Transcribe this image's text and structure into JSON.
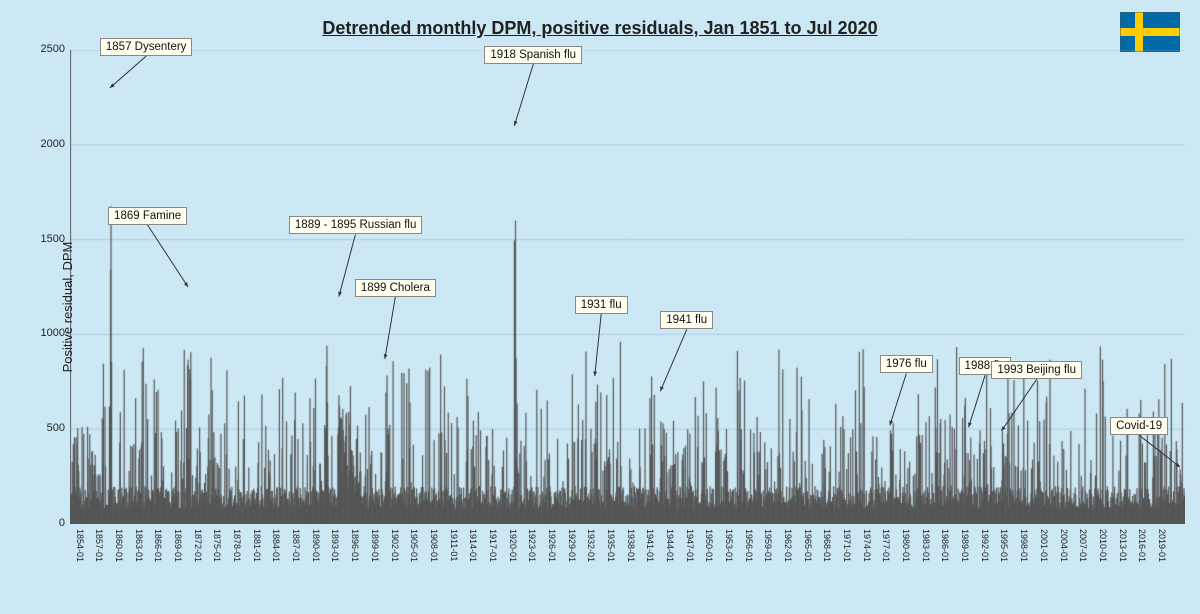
{
  "title": "Detrended monthly DPM, positive residuals, Jan 1851 to Jul 2020",
  "yAxisLabel": "Positive residual, DPM",
  "yMax": 2500,
  "yTicks": [
    0,
    500,
    1000,
    1500,
    2000,
    2500
  ],
  "annotations": [
    {
      "label": "1857 Dysentery",
      "year": 1857,
      "value": 2300
    },
    {
      "label": "1869 Famine",
      "year": 1869,
      "value": 1250
    },
    {
      "label": "1889 - 1895 Russian flu",
      "year": 1892,
      "value": 1200
    },
    {
      "label": "1899 Cholera",
      "year": 1899,
      "value": 870
    },
    {
      "label": "1918 Spanish flu",
      "year": 1918,
      "value": 2100
    },
    {
      "label": "1931 flu",
      "year": 1931,
      "value": 780
    },
    {
      "label": "1941 flu",
      "year": 1941,
      "value": 700
    },
    {
      "label": "1976 flu",
      "year": 1976,
      "value": 520
    },
    {
      "label": "1988 flu",
      "year": 1988,
      "value": 510
    },
    {
      "label": "1993 Beijing flu",
      "year": 1993,
      "value": 490
    },
    {
      "label": "Covid-19",
      "year": 2020,
      "value": 300
    }
  ],
  "colors": {
    "background": "#cce8f4",
    "bar": "#555",
    "gridLine": "#aaaacc",
    "axisLine": "#333"
  }
}
